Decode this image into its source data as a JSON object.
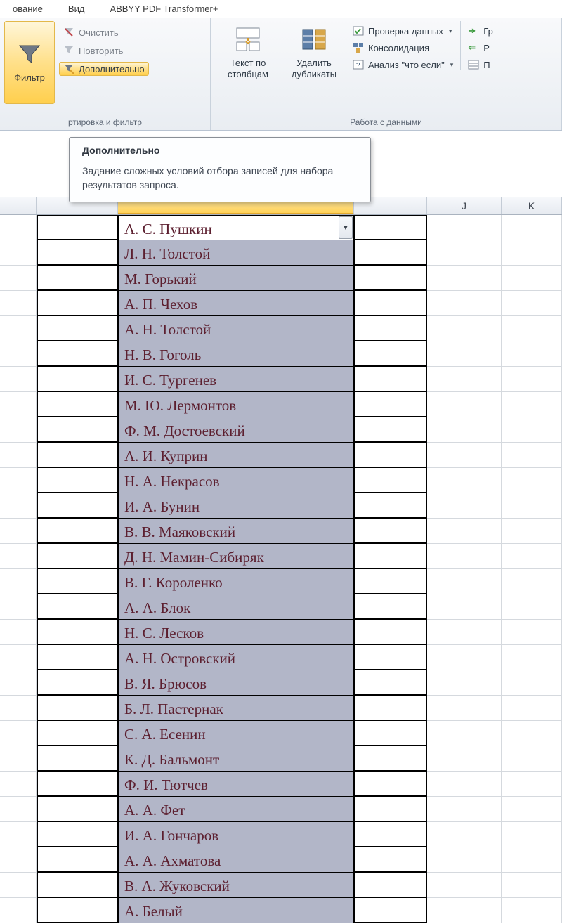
{
  "menu": {
    "items": [
      "ование",
      "Вид",
      "ABBYY PDF Transformer+"
    ]
  },
  "ribbon": {
    "filter_group_caption": "ртировка и фильтр",
    "data_group_caption": "Работа с данными",
    "filter_button": "Фильтр",
    "clear": "Очистить",
    "reapply": "Повторить",
    "advanced": "Дополнительно",
    "text_to_columns_l1": "Текст по",
    "text_to_columns_l2": "столбцам",
    "remove_dup_l1": "Удалить",
    "remove_dup_l2": "дубликаты",
    "data_validation": "Проверка данных",
    "consolidate": "Консолидация",
    "whatif": "Анализ \"что если\"",
    "right1": "Гр",
    "right2": "Р",
    "right3": "П"
  },
  "tooltip": {
    "title": "Дополнительно",
    "body": "Задание сложных условий отбора записей для набора результатов запроса."
  },
  "columns": {
    "j": "J",
    "k": "K"
  },
  "authors": [
    "А. С. Пушкин",
    "Л. Н. Толстой",
    "М. Горький",
    "А. П. Чехов",
    "А. Н. Толстой",
    "Н. В. Гоголь",
    "И. С. Тургенев",
    "М. Ю. Лермонтов",
    "Ф. М. Достоевский",
    "А. И. Куприн",
    "Н. А. Некрасов",
    "И. А. Бунин",
    "В. В. Маяковский",
    "Д. Н. Мамин-Сибиряк",
    "В. Г. Короленко",
    "А. А. Блок",
    "Н. С. Лесков",
    "А. Н. Островский",
    "В. Я. Брюсов",
    "Б. Л. Пастернак",
    "С. А. Есенин",
    "К. Д. Бальмонт",
    "Ф. И. Тютчев",
    "А. А. Фет",
    "И. А. Гончаров",
    "А. А. Ахматова",
    "В. А. Жуковский",
    "А. Белый"
  ]
}
